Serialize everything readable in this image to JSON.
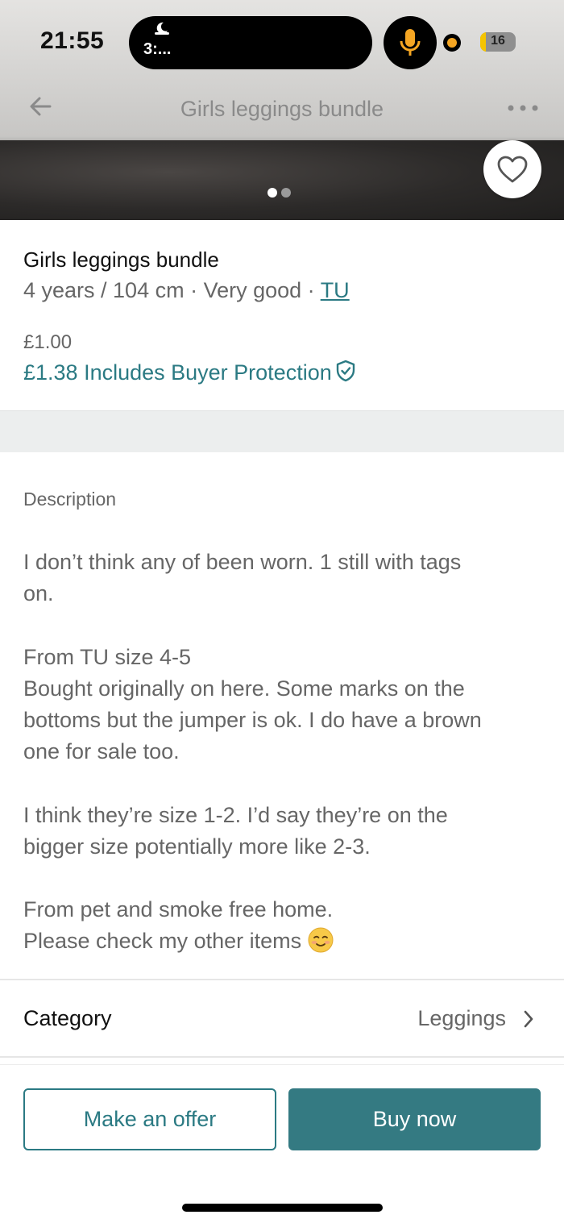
{
  "status_bar": {
    "time": "21:55",
    "island_label": "3:...",
    "battery_level": "16",
    "battery_fraction": 0.16,
    "mic_color": "#f5a623"
  },
  "nav": {
    "title": "Girls leggings bundle",
    "back_icon": "back-arrow-icon",
    "more_icon": "more-dots-icon"
  },
  "gallery": {
    "page_count": 2,
    "current_page": 1,
    "favourite_icon": "heart-icon"
  },
  "item": {
    "title": "Girls leggings bundle",
    "meta_prefix": "4 years / 104 cm · Very good · ",
    "brand": "TU",
    "price": "£1.00",
    "price_with_protection": "£1.38 Includes Buyer Protection",
    "protection_icon": "shield-check-icon"
  },
  "description": {
    "heading": "Description",
    "body": "I don’t think any of been worn. 1 still with tags\non.\n\nFrom TU size 4-5\nBought originally on here. Some marks on the\nbottoms but the jumper is ok. I do have a brown\none for sale too.\n\nI think they’re size 1-2. I’d say they’re on the\nbigger size potentially more like 2-3.\n\nFrom pet and smoke free home.\nPlease check my other items "
  },
  "category": {
    "label": "Category",
    "value": "Leggings"
  },
  "actions": {
    "offer_label": "Make an offer",
    "buy_label": "Buy now"
  },
  "colors": {
    "accent": "#2b7a83",
    "buy_button": "#347a82",
    "muted_text": "#666666"
  }
}
